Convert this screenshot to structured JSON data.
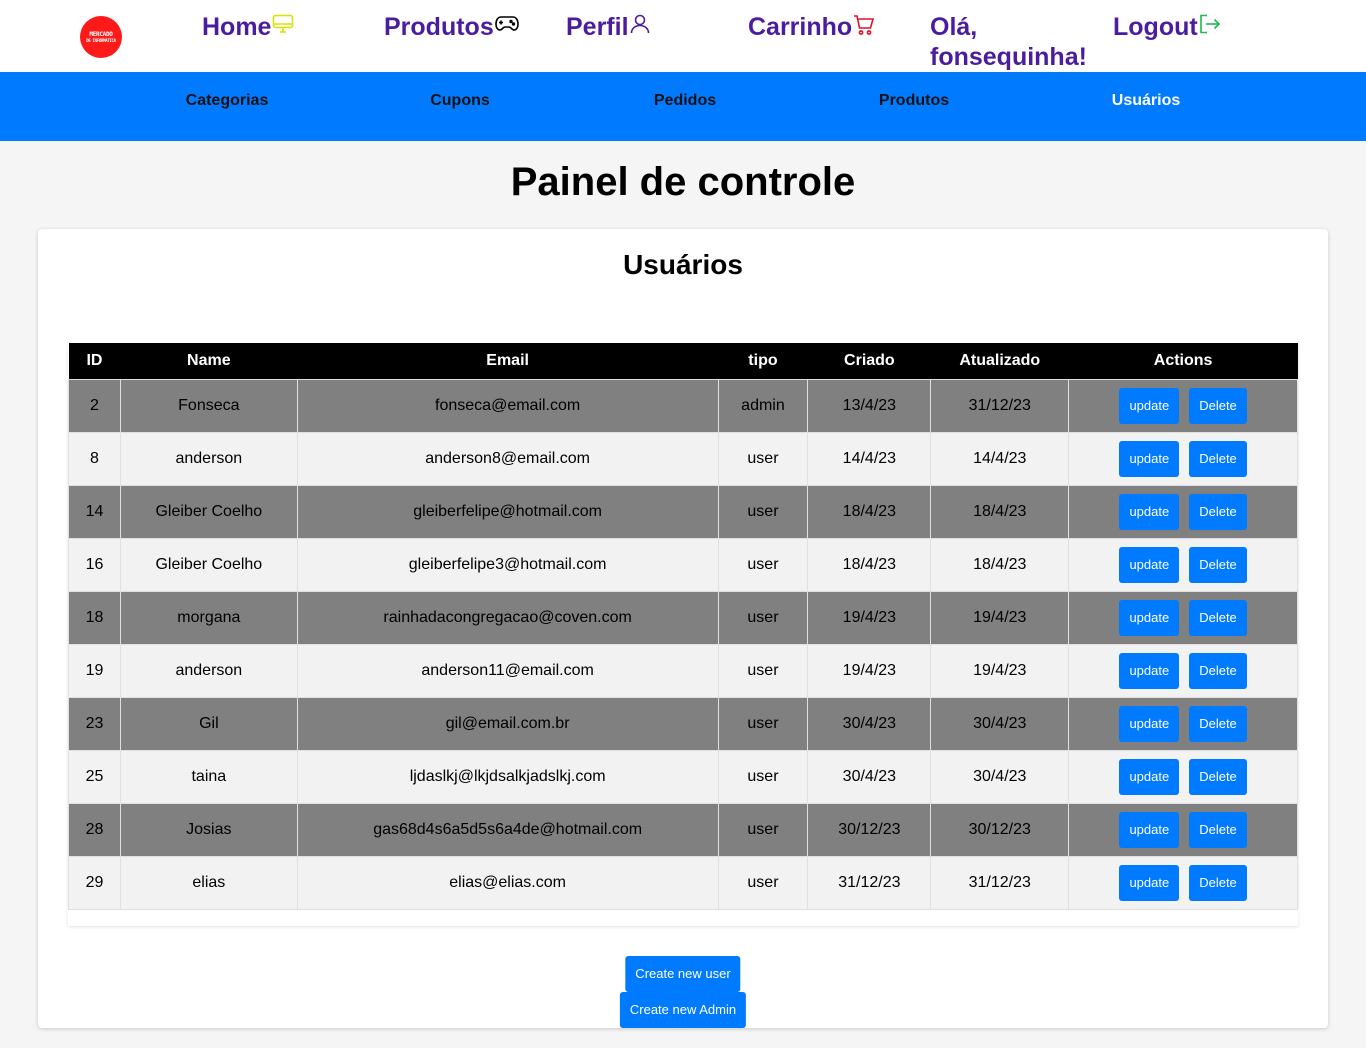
{
  "logo": {
    "line1": "MERCADO",
    "line2": "DE INFORMATICA"
  },
  "nav": {
    "home": "Home",
    "produtos": "Produtos",
    "perfil": "Perfil",
    "carrinho": "Carrinho",
    "greeting_line1": "Olá,",
    "greeting_line2": "fonsequinha!",
    "logout": "Logout"
  },
  "colors": {
    "nav_text": "#4b1d9e",
    "subnav_bg": "#007bff",
    "button": "#007bff",
    "home_icon": "#d4e600",
    "cart_icon": "#e0112b",
    "logout_icon": "#1db954"
  },
  "subnav": {
    "categorias": "Categorias",
    "cupons": "Cupons",
    "pedidos": "Pedidos",
    "produtos": "Produtos",
    "usuarios": "Usuários"
  },
  "page_title": "Painel de controle",
  "card_title": "Usuários",
  "table": {
    "headers": [
      "ID",
      "Name",
      "Email",
      "tipo",
      "Criado",
      "Atualizado",
      "Actions"
    ],
    "update_label": "update",
    "delete_label": "Delete",
    "rows": [
      [
        "2",
        "Fonseca",
        "fonseca@email.com",
        "admin",
        "13/4/23",
        "31/12/23"
      ],
      [
        "8",
        "anderson",
        "anderson8@email.com",
        "user",
        "14/4/23",
        "14/4/23"
      ],
      [
        "14",
        "Gleiber Coelho",
        "gleiberfelipe@hotmail.com",
        "user",
        "18/4/23",
        "18/4/23"
      ],
      [
        "16",
        "Gleiber Coelho",
        "gleiberfelipe3@hotmail.com",
        "user",
        "18/4/23",
        "18/4/23"
      ],
      [
        "18",
        "morgana",
        "rainhadacongregacao@coven.com",
        "user",
        "19/4/23",
        "19/4/23"
      ],
      [
        "19",
        "anderson",
        "anderson11@email.com",
        "user",
        "19/4/23",
        "19/4/23"
      ],
      [
        "23",
        "Gil",
        "gil@email.com.br",
        "user",
        "30/4/23",
        "30/4/23"
      ],
      [
        "25",
        "taina",
        "ljdaslkj@lkjdsalkjadslkj.com",
        "user",
        "30/4/23",
        "30/4/23"
      ],
      [
        "28",
        "Josias",
        "gas68d4s6a5d5s6a4de@hotmail.com",
        "user",
        "30/12/23",
        "30/12/23"
      ],
      [
        "29",
        "elias",
        "elias@elias.com",
        "user",
        "31/12/23",
        "31/12/23"
      ]
    ]
  },
  "create_user": "Create new user",
  "create_admin": "Create new Admin"
}
